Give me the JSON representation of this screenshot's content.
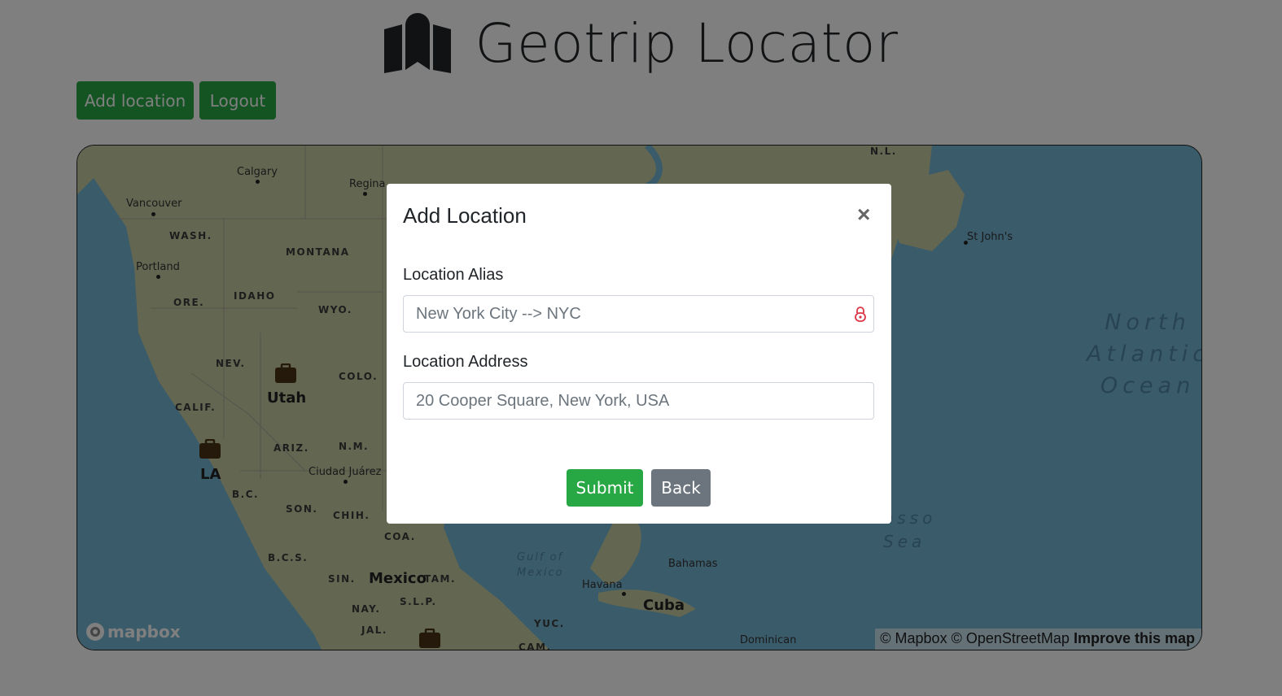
{
  "app": {
    "title": "Geotrip Locator"
  },
  "toolbar": {
    "add_location_label": "Add location",
    "logout_label": "Logout"
  },
  "map": {
    "labels": {
      "calgary": "Calgary",
      "regina": "Regina",
      "vancouver": "Vancouver",
      "wash": "WASH.",
      "montana": "MONTANA",
      "portland": "Portland",
      "idaho": "IDAHO",
      "ore": "ORE.",
      "wyo": "WYO.",
      "nev": "NEV.",
      "colo": "COLO.",
      "calif": "CALIF.",
      "ariz": "ARIZ.",
      "nm": "N.M.",
      "ciudad_juarez": "Ciudad Juárez",
      "bc": "B.C.",
      "son": "SON.",
      "chih": "CHIH.",
      "coa": "COA.",
      "bcs": "B.C.S.",
      "sin": "SIN.",
      "mexico": "Mexico",
      "tam": "TAM.",
      "slp": "S.L.P.",
      "nay": "NAY.",
      "jal": "JAL.",
      "yuc": "YUC.",
      "cam": "CAM.",
      "havana": "Havana",
      "cuba": "Cuba",
      "bahamas": "Bahamas",
      "dominican": "Dominican",
      "nl": "N.L.",
      "st_johns": "St John's",
      "gulf": "Gulf of Mexico",
      "sargasso": "asso Sea",
      "ocean": "North Atlantic Ocean"
    },
    "markers": [
      {
        "name": "Utah",
        "label": "Utah"
      },
      {
        "name": "LA",
        "label": "LA"
      },
      {
        "name": "Mexico",
        "label": ""
      }
    ],
    "logo": "mapbox",
    "attribution": {
      "mapbox": "© Mapbox",
      "osm": "© OpenStreetMap",
      "improve": "Improve this map"
    }
  },
  "modal": {
    "title": "Add Location",
    "close_symbol": "×",
    "alias_label": "Location Alias",
    "alias_placeholder": "New York City --> NYC",
    "address_label": "Location Address",
    "address_placeholder": "20 Cooper Square, New York, USA",
    "submit_label": "Submit",
    "back_label": "Back"
  },
  "colors": {
    "primary_green": "#28a745",
    "secondary_grey": "#6c757d",
    "overlay": "rgba(0,0,0,0.5)",
    "lock_icon": "#dc3545"
  }
}
